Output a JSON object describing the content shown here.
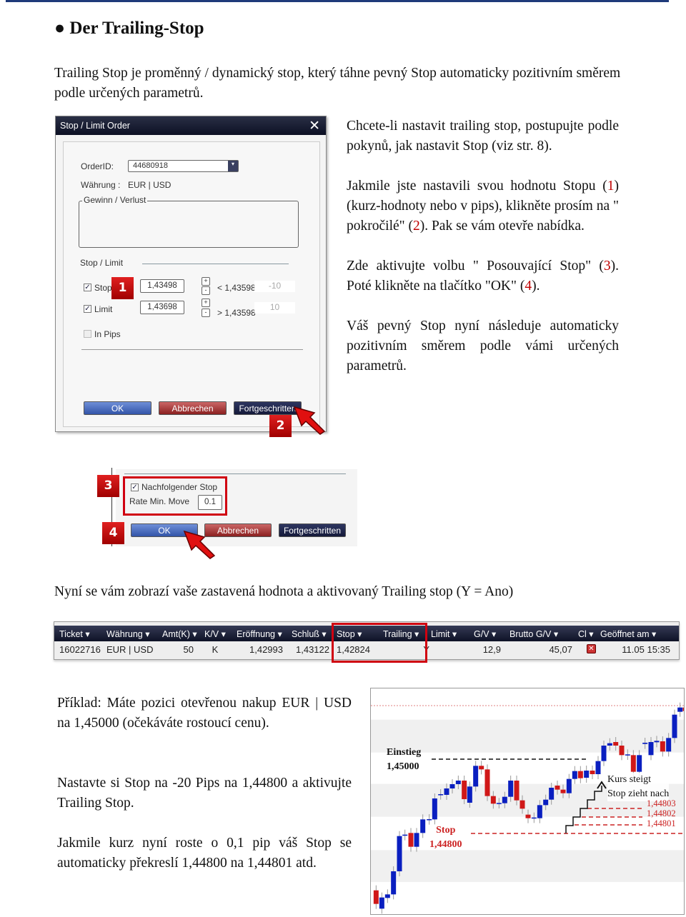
{
  "heading": "Der Trailing-Stop",
  "intro": "Trailing Stop je proměnný / dynamický stop, který táhne pevný Stop automaticky pozitivním směrem podle určených parametrů.",
  "right": {
    "p1": "Chcete-li nastavit trailing stop, postupujte podle pokynů, jak nastavit Stop (viz str. 8).",
    "p2a": "Jakmile jste nastavili svou hodnotu Stopu (",
    "n1": "1",
    "p2b": ") (kurz-hodnoty nebo v pips), klikněte prosím na \" pokročilé\" (",
    "n2": "2",
    "p2c": "). Pak se vám otevře nabídka.",
    "p3a": "Zde aktivujte volbu \" Posouvající Stop\" (",
    "n3": "3",
    "p3b": "). Poté klikněte na tlačítko \"OK\" (",
    "n4": "4",
    "p3c": ").",
    "p4": "Váš pevný Stop nyní následuje automaticky pozitivním směrem podle vámi určených parametrů."
  },
  "dialog": {
    "title": "Stop / Limit Order",
    "order_label": "OrderID:",
    "order_value": "44680918",
    "currency_label": "Währung :",
    "currency_value": "EUR | USD",
    "pl_label": "Gewinn / Verlust",
    "sl_label": "Stop / Limit",
    "stop_label": "Stop",
    "stop_value": "1,43498",
    "stop_ref": "< 1,43598",
    "stop_pips": "-10",
    "limit_label": "Limit",
    "limit_value": "1,43698",
    "limit_ref": "> 1,43598",
    "limit_pips": "10",
    "pips_label": "In Pips",
    "ok": "OK",
    "cancel": "Abbrechen",
    "advanced": "Fortgeschritten",
    "plus": "+",
    "minus": "-",
    "stop_checked": true,
    "limit_checked": true,
    "pips_checked": false
  },
  "dialog2": {
    "trailing_label": "Nachfolgender Stop",
    "trailing_checked": true,
    "rate_label": "Rate Min. Move",
    "rate_value": "0.1",
    "ok": "OK",
    "cancel": "Abbrechen",
    "advanced": "Fortgeschritten"
  },
  "badges": [
    "1",
    "2",
    "3",
    "4"
  ],
  "table_intro": "Nyní se vám zobrazí vaše zastavená hodnota a aktivovaný Trailing stop (Y = Ano)",
  "table": {
    "headers": [
      "Ticket ▾",
      "Währung ▾",
      "Amt(K) ▾",
      "K/V ▾",
      "Eröffnung ▾",
      "Schluß ▾",
      "Stop ▾",
      "Trailing ▾",
      "Limit ▾",
      "G/V ▾",
      "Brutto G/V ▾",
      "Cl ▾",
      "Geöffnet am ▾"
    ],
    "row": [
      "16022716",
      "EUR | USD",
      "50",
      "K",
      "1,42993",
      "1,43122",
      "1,42824",
      "Y",
      "",
      "12,9",
      "45,07",
      "",
      "11.05 15:35"
    ]
  },
  "example": {
    "p1": "Příklad: Máte pozici otevřenou nakup EUR | USD na 1,45000 (očekáváte rostoucí cenu).",
    "p2": "Nastavte si Stop na -20 Pips na 1,44800 a aktivujte Trailing Stop.",
    "p3": "Jakmile kurz nyní roste o 0,1 pip váš Stop se automaticky překreslí 1,44800 na 1,44801 atd."
  },
  "chart": {
    "entry_label": "Einstieg",
    "entry_value": "1,45000",
    "stop_label": "Stop",
    "stop_value": "1,44800",
    "note1": "Kurs steigt",
    "note2": "Stop zieht nach",
    "levels": [
      "1,44803",
      "1,44802",
      "1,44801"
    ],
    "colors": {
      "up": "#0a1fc0",
      "down": "#d01818",
      "stop": "#cc2222"
    }
  }
}
